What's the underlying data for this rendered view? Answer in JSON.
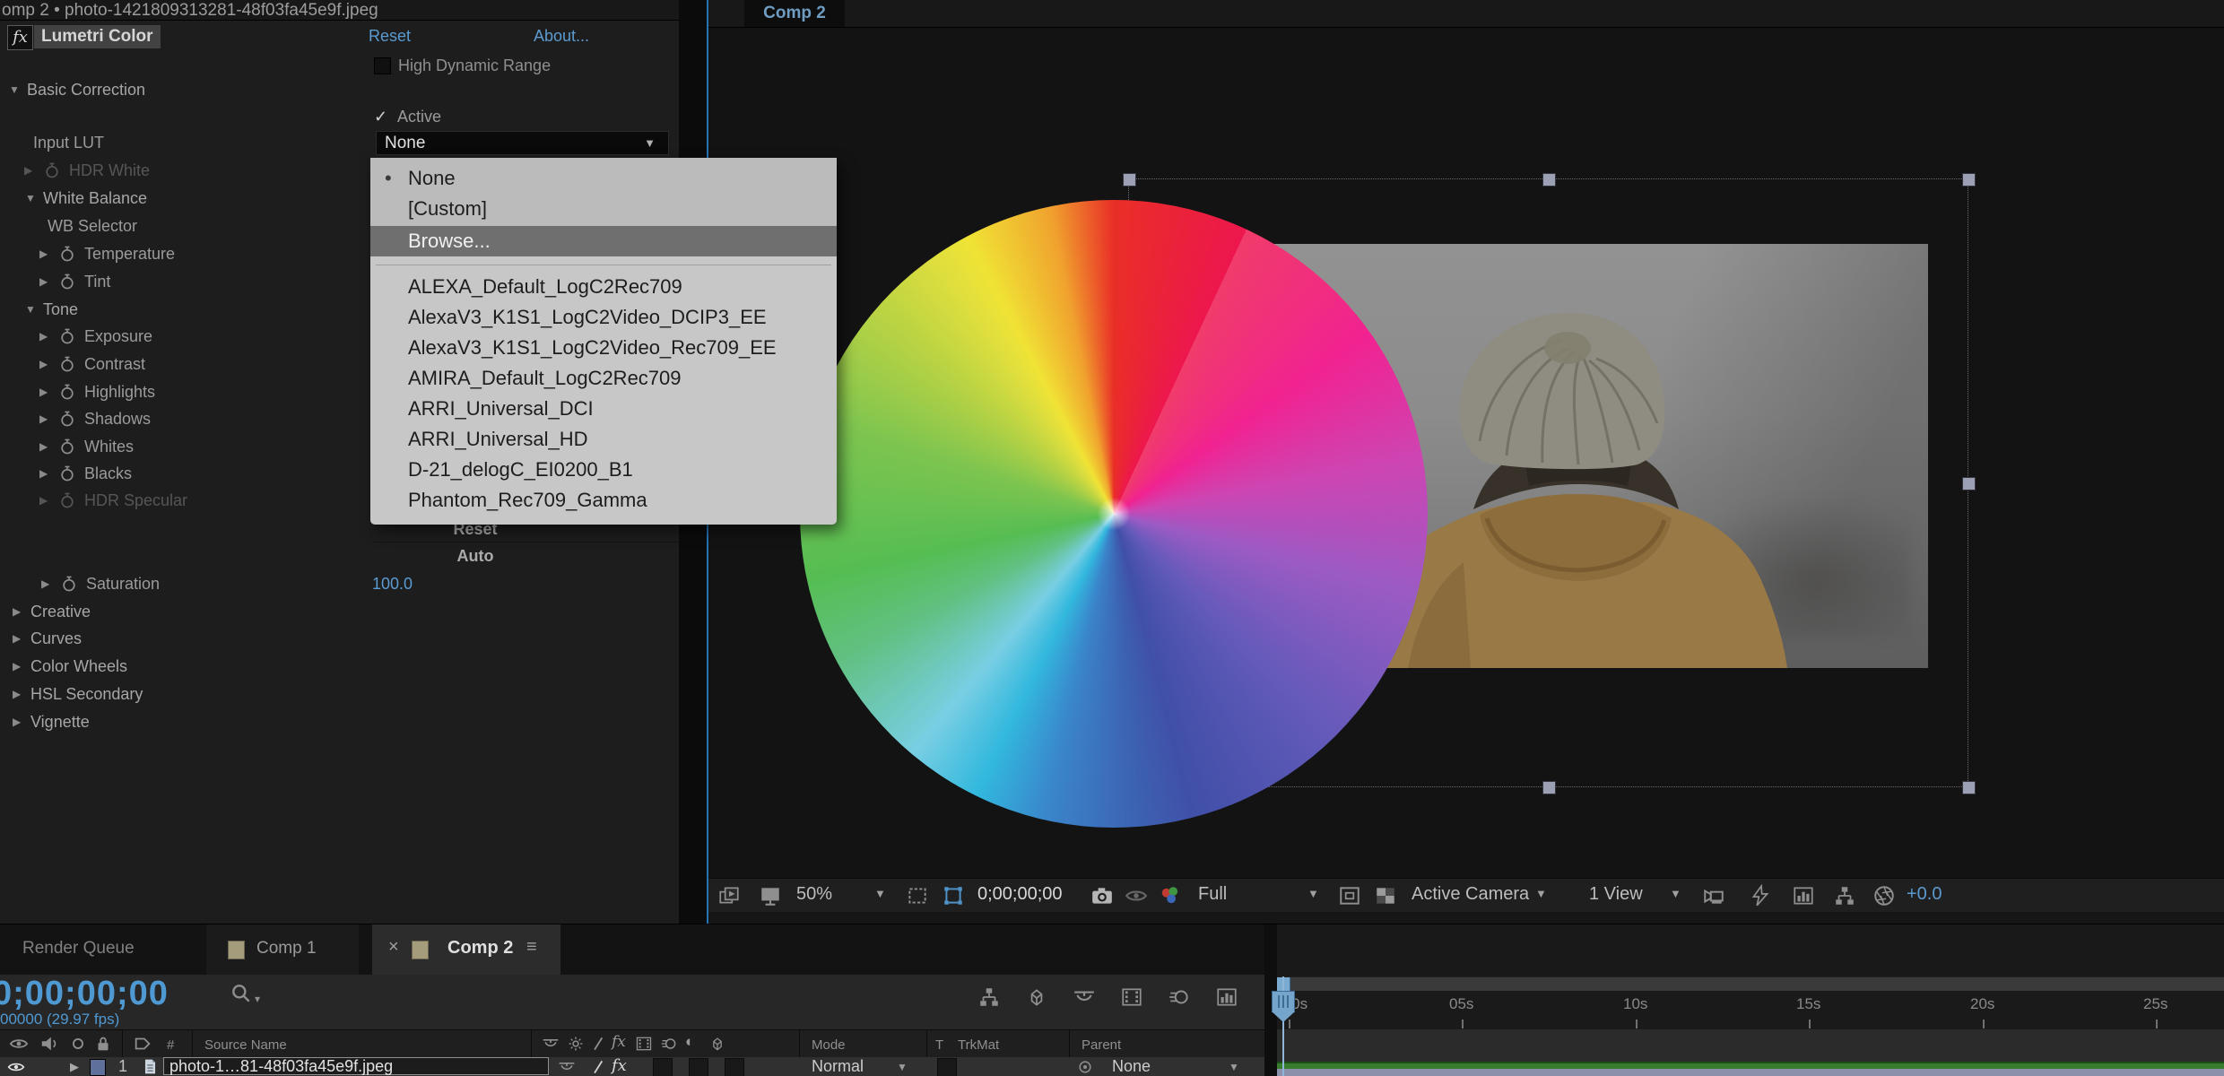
{
  "colors": {
    "accent_blue": "#5b9bd1",
    "timecode_blue": "#4f99d3",
    "menu_bg": "#c7c7c7",
    "menu_highlight": "#6f6f6f",
    "render_bar_green": "#3a7c2e",
    "layer_bar_lavender": "#8d90aa",
    "layer_label_blue": "#5f719a",
    "comp_icon_tan": "#a59c7b",
    "mask_tool_blue": "#4f93c9"
  },
  "glyphs": {
    "expand": "▶",
    "collapse": "▼",
    "dropdown": "▼",
    "dropdown_small": "▾",
    "check": "✓",
    "bullet": "•",
    "half_circle": "◐",
    "slash": "/",
    "fx": "fx"
  },
  "effect_panel": {
    "panel_title": "omp 2 • photo-1421809313281-48f03fa45e9f.jpeg",
    "header": {
      "fx_badge": "fx",
      "effect_name": "Lumetri Color",
      "reset": "Reset",
      "about": "About..."
    },
    "hdr_label": "High Dynamic Range",
    "active_label": "Active",
    "lut_select_value": "None",
    "rows": {
      "basic_correction": "Basic Correction",
      "input_lut": "Input LUT",
      "hdr_white": "HDR White",
      "white_balance": "White Balance",
      "wb_selector": "WB Selector",
      "temperature": "Temperature",
      "tint": "Tint",
      "tone": "Tone",
      "exposure": "Exposure",
      "contrast": "Contrast",
      "highlights": "Highlights",
      "shadows": "Shadows",
      "whites": "Whites",
      "blacks": "Blacks",
      "hdr_specular": "HDR Specular",
      "saturation": "Saturation",
      "creative": "Creative",
      "curves": "Curves",
      "color_wheels": "Color Wheels",
      "hsl_secondary": "HSL Secondary",
      "vignette": "Vignette"
    },
    "saturation_value": "100.0",
    "tone_buttons": {
      "reset": "Reset",
      "auto": "Auto"
    }
  },
  "lut_menu": {
    "selected_item": "None",
    "highlighted_item": "Browse...",
    "items": [
      "None",
      "[Custom]",
      "Browse...",
      "ALEXA_Default_LogC2Rec709",
      "AlexaV3_K1S1_LogC2Video_DCIP3_EE",
      "AlexaV3_K1S1_LogC2Video_Rec709_EE",
      "AMIRA_Default_LogC2Rec709",
      "ARRI_Universal_DCI",
      "ARRI_Universal_HD",
      "D-21_delogC_EI0200_B1",
      "Phantom_Rec709_Gamma"
    ]
  },
  "viewer": {
    "tab": "Comp 2",
    "toolbar": {
      "magnification": "50%",
      "timecode": "0;00;00;00",
      "resolution": "Full",
      "camera_view": "Active Camera",
      "view_layout": "1 View",
      "exposure_gain": "+0.0"
    }
  },
  "timeline": {
    "tabs": {
      "render_queue": "Render Queue",
      "comp_1": "Comp 1",
      "comp_2": "Comp 2",
      "close_glyph": "×",
      "menu_glyph": "≡"
    },
    "current_timecode": "0;00;00;00",
    "frame_readout": "00000 (29.97 fps)",
    "columns": {
      "hash": "#",
      "source_name": "Source Name",
      "mode": "Mode",
      "t": "T",
      "trkmat": "TrkMat",
      "parent": "Parent"
    },
    "layer": {
      "index": "1",
      "name": "photo-1…81-48f03fa45e9f.jpeg",
      "mode": "Normal",
      "parent": "None"
    },
    "ruler_labels": [
      ":00s",
      "05s",
      "10s",
      "15s",
      "20s",
      "25s"
    ]
  }
}
